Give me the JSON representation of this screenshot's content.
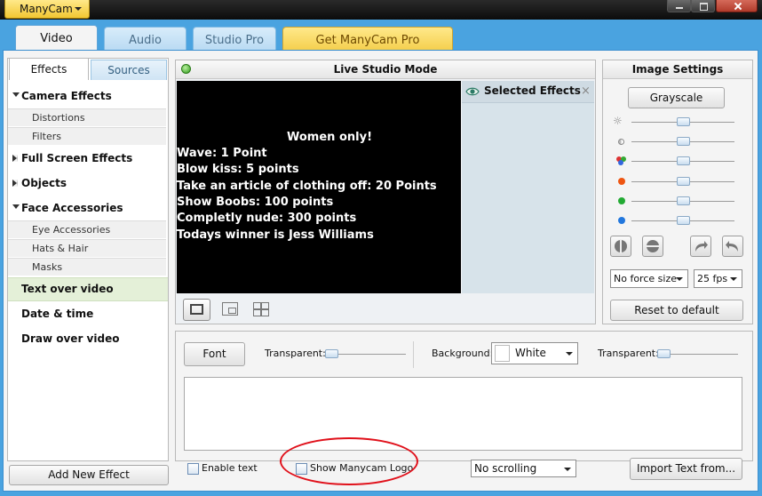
{
  "window": {
    "app_menu_label": "ManyCam"
  },
  "main_tabs": [
    {
      "label": "Video"
    },
    {
      "label": "Audio"
    },
    {
      "label": "Studio Pro"
    },
    {
      "label": "Get ManyCam Pro"
    }
  ],
  "left_panel": {
    "tabs": [
      {
        "label": "Effects"
      },
      {
        "label": "Sources"
      }
    ],
    "categories": {
      "camera_effects": "Camera Effects",
      "distortions": "Distortions",
      "filters": "Filters",
      "full_screen_effects": "Full Screen Effects",
      "objects": "Objects",
      "face_accessories": "Face Accessories",
      "eye_accessories": "Eye Accessories",
      "hats_hair": "Hats & Hair",
      "masks": "Masks",
      "text_over_video": "Text over video",
      "date_time": "Date & time",
      "draw_over_video": "Draw over video"
    },
    "add_effect_label": "Add New Effect"
  },
  "live_studio": {
    "title": "Live Studio Mode",
    "video_text": [
      "Women only!",
      "Wave: 1 Point",
      "Blow kiss: 5 points",
      "Take an article of clothing off: 20 Points",
      "Show Boobs: 100 points",
      "Completly nude: 300 points",
      "Todays winner is Jess Williams"
    ],
    "selected_effects_label": "Selected Effects",
    "close_glyph": "×"
  },
  "image_settings": {
    "title": "Image Settings",
    "grayscale_label": "Grayscale",
    "slider_icons": [
      "brightness-icon",
      "contrast-icon",
      "color-icon",
      "red-channel-icon",
      "green-channel-icon",
      "blue-channel-icon"
    ],
    "slider_colors": [
      "#999999",
      "#999999",
      "#cc4444",
      "#ee5511",
      "#22aa33",
      "#2277dd"
    ],
    "force_size_value": "No force size",
    "fps_value": "25 fps",
    "reset_label": "Reset to default"
  },
  "text_settings": {
    "font_label": "Font",
    "transparent_label_1": "Transparent:",
    "background_label": "Background:",
    "background_value": "White",
    "transparent_label_2": "Transparent:",
    "text_value": "",
    "enable_text_label": "Enable text",
    "enable_text_checked": false,
    "show_logo_label": "Show Manycam Logo",
    "show_logo_checked": false,
    "scrolling_value": "No scrolling",
    "import_label": "Import Text from..."
  }
}
